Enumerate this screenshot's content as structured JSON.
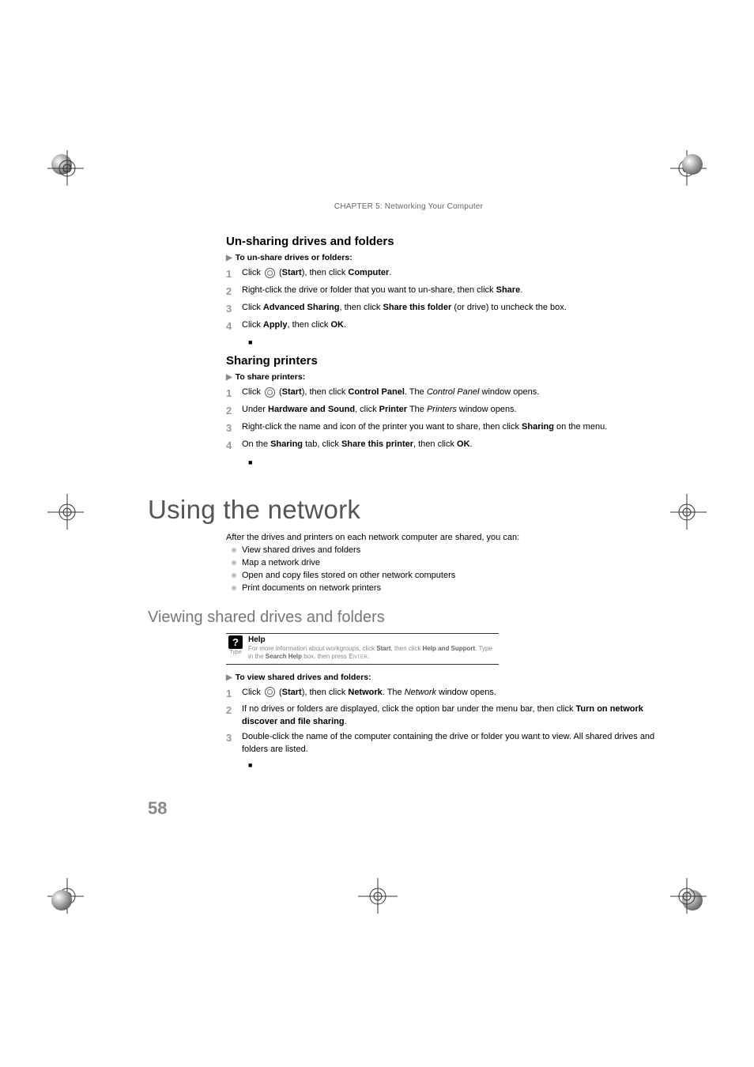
{
  "chapter_header": "CHAPTER 5: Networking Your Computer",
  "unshare": {
    "title": "Un-sharing drives and folders",
    "task": "To un-share drives or folders:",
    "s1_a": "Click ",
    "s1_b": " (",
    "s1_c": "Start",
    "s1_d": "), then click ",
    "s1_e": "Computer",
    "s1_f": ".",
    "s2_a": "Right-click the drive or folder that you want to un-share, then click ",
    "s2_b": "Share",
    "s2_c": ".",
    "s3_a": "Click ",
    "s3_b": "Advanced Sharing",
    "s3_c": ", then click ",
    "s3_d": "Share this folder",
    "s3_e": " (or drive) to uncheck the box.",
    "s4_a": "Click ",
    "s4_b": "Apply",
    "s4_c": ", then click ",
    "s4_d": "OK",
    "s4_e": "."
  },
  "printers": {
    "title": "Sharing printers",
    "task": "To share printers:",
    "s1_a": "Click ",
    "s1_b": " (",
    "s1_c": "Start",
    "s1_d": "), then click ",
    "s1_e": "Control Panel",
    "s1_f": ". The ",
    "s1_g": "Control Panel",
    "s1_h": " window opens.",
    "s2_a": "Under ",
    "s2_b": "Hardware and Sound",
    "s2_c": ", click ",
    "s2_d": "Printer",
    "s2_e": " The ",
    "s2_f": "Printers",
    "s2_g": " window opens.",
    "s3_a": "Right-click the name and icon of the printer you want to share, then click ",
    "s3_b": "Sharing",
    "s3_c": " on the menu.",
    "s4_a": "On the ",
    "s4_b": "Sharing",
    "s4_c": " tab, click ",
    "s4_d": "Share this printer",
    "s4_e": ", then click ",
    "s4_f": "OK",
    "s4_g": "."
  },
  "using": {
    "h1": "Using the network",
    "intro": "After the drives and printers on each network computer are shared, you can:",
    "b1": "View shared drives and folders",
    "b2": "Map a network drive",
    "b3": "Open and copy files stored on other network computers",
    "b4": "Print documents on network printers",
    "h2": "Viewing shared drives and folders",
    "help_title": "Help",
    "help_body_a": "For more information about workgroups, click ",
    "help_body_b": "Start",
    "help_body_c": ", then click ",
    "help_body_d": "Help and Support",
    "help_body_e": ". Type ",
    "help_body_f": "",
    "help_body_g": " in the ",
    "help_body_h": "Search Help",
    "help_body_i": " box, then press ",
    "help_body_j": "Enter",
    "help_body_k": ".",
    "help_type": "Type",
    "task": "To view shared drives and folders:",
    "s1_a": "Click ",
    "s1_b": " (",
    "s1_c": "Start",
    "s1_d": "), then click ",
    "s1_e": "Network",
    "s1_f": ". The ",
    "s1_g": "Network",
    "s1_h": " window opens.",
    "s2_a": "If no drives or folders are displayed, click the option bar under the menu bar, then click ",
    "s2_b": "Turn on network discover and file sharing",
    "s2_c": ".",
    "s3_a": "Double-click the name of the computer containing the drive or folder you want to view. All shared drives and folders are listed."
  },
  "nums": {
    "n1": "1",
    "n2": "2",
    "n3": "3",
    "n4": "4"
  },
  "end": "■",
  "tri": "▶",
  "page_num": "58",
  "help_q": "?"
}
